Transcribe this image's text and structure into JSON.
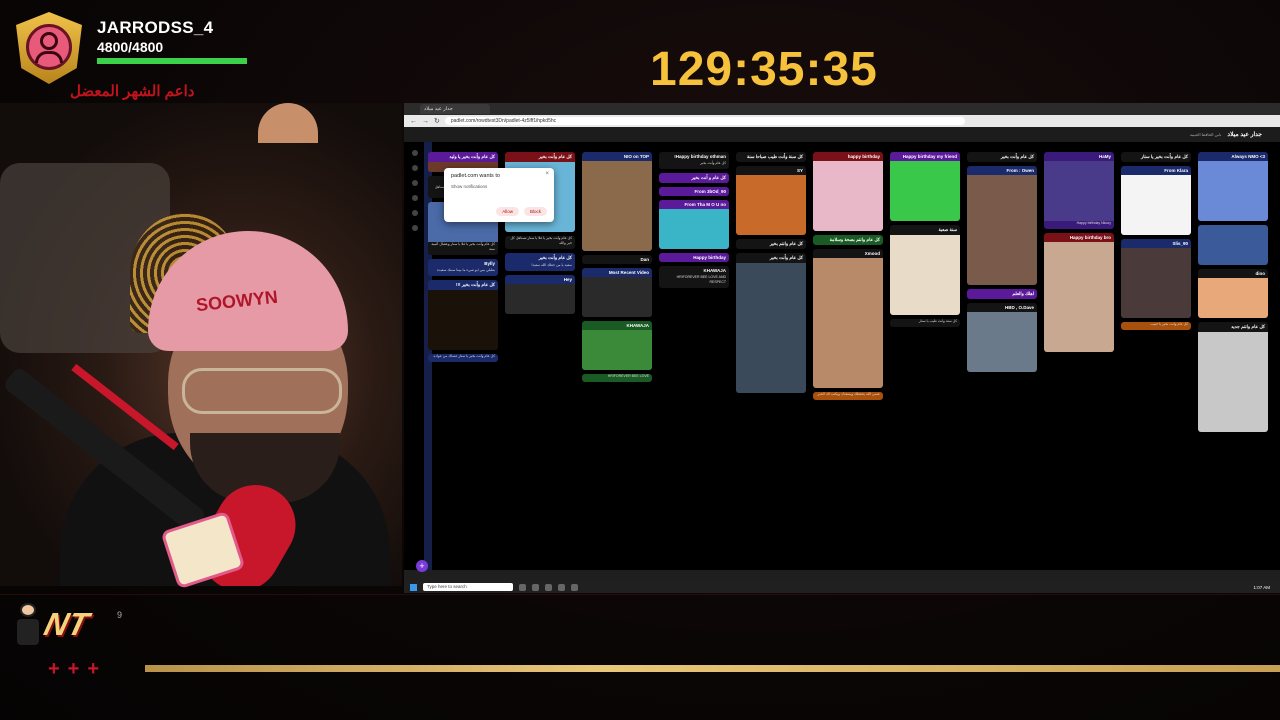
{
  "overlay": {
    "username": "JARRODSS_4",
    "hp_text": "4800/4800",
    "hp_fraction": 1.0,
    "supporter_label": "داعم الشهر المعضل",
    "timer": "129:35:35",
    "bottom_plus": "+++",
    "logo_text": "NT",
    "logo_sup": "9",
    "beanie_text": "SOOWYN"
  },
  "browser": {
    "tab_label": "جدار عيد ميلاد",
    "url": "padlet.com/rowdtest3Dn/padlet-4z5lff1ihpkd5hc",
    "padlet_title": "جدار عيد ميلاد",
    "padlet_subtitle": "نابي الحافظ الحبيبه",
    "taskbar_search": "Type here to search",
    "clock": "1:07 AM",
    "popup": {
      "line1": "padlet.com wants to",
      "line2": "Show notifications",
      "allow": "Allow",
      "block": "Block"
    }
  },
  "columns": [
    {
      "cards": [
        {
          "style": "c-purple",
          "title": "كل عام وأنت بخير يا وليد",
          "text": "",
          "img": "#6c3a2a",
          "h": 10
        },
        {
          "style": "c-black",
          "title": "CQ",
          "text": "كل عام وأنت بخير يا اخوي وحبيبي تستاهل كل خير",
          "img": "",
          "h": 0
        },
        {
          "style": "c-black",
          "title": "",
          "text": "كل عام وأنت بخير يا غلا يا ستار وعقبال المية سنة",
          "img": "#4a6aa8",
          "h": 40
        },
        {
          "style": "c-navy",
          "title": "Bylly",
          "text": "بطبلي بس ابو شيء ما بيبتا سنتك سعيدة",
          "img": "",
          "h": 0
        },
        {
          "style": "c-navy",
          "title": "كل عام وأنت بخير !!!",
          "text": "",
          "img": "#1a1208",
          "h": 60
        },
        {
          "style": "c-navy",
          "title": "",
          "text": "كل عام وأنت بخير يا ستار عساك من عواده",
          "img": "",
          "h": 0
        }
      ]
    },
    {
      "cards": [
        {
          "style": "c-red",
          "title": "كل عام وأنت بخير",
          "text": "",
          "img": "#69b5d8",
          "h": 70
        },
        {
          "style": "c-black",
          "title": "",
          "text": "كل عام وأنت بخير يا غلا يا ستار تستاهل كل خير والله",
          "img": "",
          "h": 0
        },
        {
          "style": "c-navy",
          "title": "كل عام وأنت بخير",
          "text": "سعيد يا من جعلك الله سعيدا",
          "img": "",
          "h": 0
        },
        {
          "style": "c-navy",
          "title": "Hey",
          "text": "",
          "img": "#2a2a2a",
          "h": 30
        }
      ]
    },
    {
      "cards": [
        {
          "style": "c-navy",
          "title": "NIO on TOP",
          "text": "",
          "img": "#8a6a4a",
          "h": 90
        },
        {
          "style": "c-black",
          "title": "Dan",
          "text": "",
          "img": "",
          "h": 0
        },
        {
          "style": "c-navy",
          "title": "Most Recent Video",
          "text": "",
          "img": "#2a2a2a",
          "h": 40
        },
        {
          "style": "c-green",
          "title": "KHAWAJA",
          "text": "",
          "img": "#3a8a3a",
          "h": 40
        },
        {
          "style": "c-green",
          "title": "",
          "text": "HRIFOREVER BEE LOVE",
          "img": "",
          "h": 0
        }
      ]
    },
    {
      "cards": [
        {
          "style": "c-black",
          "title": "Happy birthday othman!",
          "text": "كل عام وأنت بخير",
          "img": "",
          "h": 0
        },
        {
          "style": "c-purple",
          "title": "كل عام و أنت بخير",
          "text": "",
          "img": "",
          "h": 0
        },
        {
          "style": "c-purple",
          "title": "From 3bOd_90",
          "text": "",
          "img": "",
          "h": 0
        },
        {
          "style": "c-purple",
          "title": "From Tha M O U no",
          "text": "",
          "img": "#3ab5c8",
          "h": 40
        },
        {
          "style": "c-purple",
          "title": "Happy birthday",
          "text": "",
          "img": "",
          "h": 0
        },
        {
          "style": "c-black",
          "title": "KHAWAJA",
          "text": "HRIFOREVER BEE LOVE AND RESPECT",
          "img": "",
          "h": 0
        }
      ]
    },
    {
      "cards": [
        {
          "style": "c-black",
          "title": "كل سنة وأنت طيب صباحا سنة",
          "text": "",
          "img": "",
          "h": 0
        },
        {
          "style": "c-black",
          "title": "SY",
          "text": "",
          "img": "#c86a2a",
          "h": 60
        },
        {
          "style": "c-black",
          "title": "كل عام وانتم بخير",
          "text": "",
          "img": "",
          "h": 0
        },
        {
          "style": "c-black",
          "title": "كل عام وأنت بخير",
          "text": "",
          "img": "#3a4a5a",
          "h": 130
        }
      ]
    },
    {
      "cards": [
        {
          "style": "c-red",
          "title": "happy birthday",
          "text": "",
          "img": "#e8b8c8",
          "h": 70
        },
        {
          "style": "c-green",
          "title": "كل عام وانتم بصحة وسلامة",
          "text": "",
          "img": "",
          "h": 0
        },
        {
          "style": "c-black",
          "title": "Xmood",
          "text": "",
          "img": "#b88a6a",
          "h": 130
        },
        {
          "style": "c-orange",
          "title": "",
          "text": "عسى الله يحفظك ويسعدك ويكتب لك الخير",
          "img": "",
          "h": 0
        }
      ]
    },
    {
      "cards": [
        {
          "style": "c-purple",
          "title": "Happy birthday my friend",
          "text": "",
          "img": "#3ac84a",
          "h": 60
        },
        {
          "style": "c-black",
          "title": "سنة صعبة",
          "text": "",
          "img": "#e8dcc8",
          "h": 80
        },
        {
          "style": "c-black",
          "title": "",
          "text": "كل سنة وانت طيب يا ستار",
          "img": "",
          "h": 0
        }
      ]
    },
    {
      "cards": [
        {
          "style": "c-black",
          "title": "كل عام وأنت بخير",
          "text": "",
          "img": "",
          "h": 0
        },
        {
          "style": "c-navy",
          "title": "From : Owen",
          "text": "",
          "img": "#7a5a4a",
          "h": 110
        },
        {
          "style": "c-purple",
          "title": "اهلك والعلم",
          "text": "",
          "img": "",
          "h": 0
        },
        {
          "style": "c-black",
          "title": "HBD , O.Dave",
          "text": "",
          "img": "#6a7a8a",
          "h": 60
        }
      ]
    },
    {
      "cards": [
        {
          "style": "c-violet",
          "title": "HaMy",
          "text": "Happy birthday Nkooy",
          "img": "#4a3a8a",
          "h": 60
        },
        {
          "style": "c-red",
          "title": "Happy birthday bro",
          "text": "",
          "img": "#c8a890",
          "h": 110
        }
      ]
    },
    {
      "cards": [
        {
          "style": "c-black",
          "title": "كل عام وأنت بخير يا ستار",
          "text": "",
          "img": "",
          "h": 0
        },
        {
          "style": "c-navy",
          "title": "From Klara",
          "text": "",
          "img": "#f4f4f4",
          "h": 60
        },
        {
          "style": "c-navy",
          "title": "Slis_90",
          "text": "",
          "img": "#4a3a3a",
          "h": 70
        },
        {
          "style": "c-orange",
          "title": "",
          "text": "كل عام وانت بخير يا حبيب",
          "img": "",
          "h": 0
        }
      ]
    },
    {
      "cards": [
        {
          "style": "c-navy",
          "title": "Always NMO <3",
          "text": "",
          "img": "#6a8ad8",
          "h": 60
        },
        {
          "style": "c-black",
          "title": "",
          "text": "",
          "img": "#3a5a9a",
          "h": 40
        },
        {
          "style": "c-black",
          "title": "dino",
          "text": "",
          "img": "#e8a87a",
          "h": 40
        },
        {
          "style": "c-black",
          "title": "كل عام وانتم جديد",
          "text": "",
          "img": "#c8c8c8",
          "h": 100
        }
      ]
    }
  ]
}
